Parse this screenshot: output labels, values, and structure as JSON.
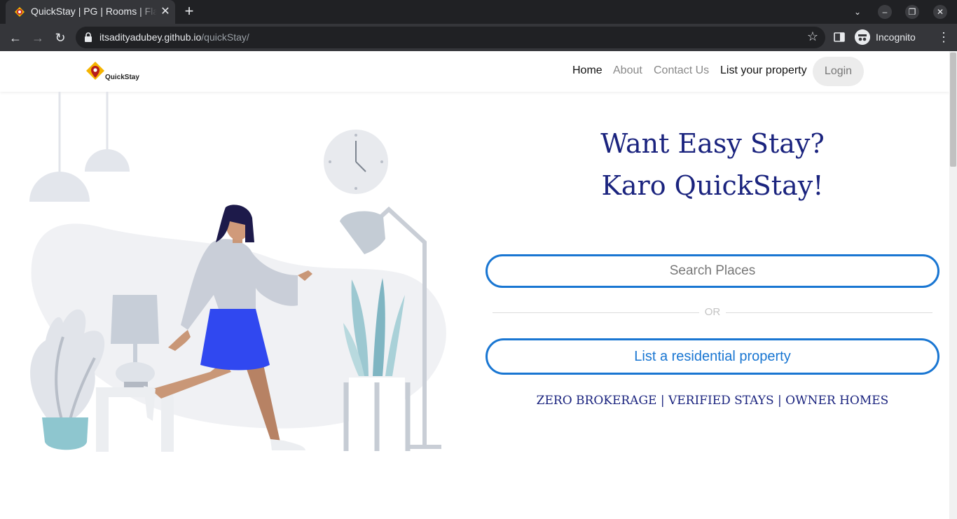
{
  "browser": {
    "tab_title": "QuickStay | PG | Rooms | Flats",
    "tab_close_icon": "close-icon",
    "new_tab_icon": "plus-icon",
    "url_host": "itsadityadubey.github.io",
    "url_path": "/quickStay/",
    "profile_label": "Incognito",
    "colors": {
      "frame": "#202124",
      "toolbar": "#35363a"
    }
  },
  "site": {
    "logo_text": "QuickStay",
    "nav": [
      {
        "label": "Home",
        "color": "#111111"
      },
      {
        "label": "About",
        "color": "#888888"
      },
      {
        "label": "Contact Us",
        "color": "#888888"
      },
      {
        "label": "List your property",
        "color": "#111111"
      }
    ],
    "login_label": "Login"
  },
  "hero": {
    "headline_line1": "Want Easy Stay?",
    "headline_line2": "Karo QuickStay!",
    "search_placeholder": "Search Places",
    "or_label": "OR",
    "list_button_label": "List a residential property",
    "tagline": "ZERO BROKERAGE | VERIFIED STAYS | OWNER HOMES",
    "colors": {
      "headline": "#1a237e",
      "accent": "#1976d2"
    }
  }
}
